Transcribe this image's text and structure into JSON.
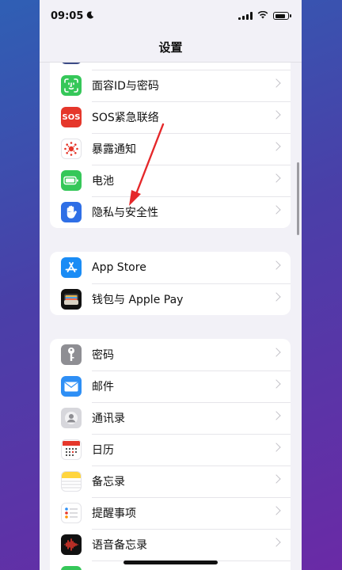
{
  "status": {
    "time": "09:05"
  },
  "nav": {
    "title": "设置"
  },
  "groups": [
    {
      "items": [
        {
          "label": "面容ID与密码",
          "icon": "face-id-icon",
          "color": "#35c759"
        },
        {
          "label": "SOS紧急联络",
          "icon": "sos-icon",
          "color": "#e5372b"
        },
        {
          "label": "暴露通知",
          "icon": "exposure-icon",
          "color": "#ffffff"
        },
        {
          "label": "电池",
          "icon": "battery-icon",
          "color": "#35c759"
        },
        {
          "label": "隐私与安全性",
          "icon": "hand-icon",
          "color": "#2f6fe6"
        }
      ]
    },
    {
      "items": [
        {
          "label": "App Store",
          "icon": "app-store-icon",
          "color": "#1a8cf5"
        },
        {
          "label": "钱包与 Apple Pay",
          "icon": "wallet-icon",
          "color": "#111111"
        }
      ]
    },
    {
      "items": [
        {
          "label": "密码",
          "icon": "key-icon",
          "color": "#8e8e93"
        },
        {
          "label": "邮件",
          "icon": "mail-icon",
          "color": "#2e8ff5"
        },
        {
          "label": "通讯录",
          "icon": "contacts-icon",
          "color": "#d7d7dc"
        },
        {
          "label": "日历",
          "icon": "calendar-icon",
          "color": "#ffffff"
        },
        {
          "label": "备忘录",
          "icon": "notes-icon",
          "color": "#ffd53e"
        },
        {
          "label": "提醒事项",
          "icon": "reminders-icon",
          "color": "#ffffff"
        },
        {
          "label": "语音备忘录",
          "icon": "voice-memos-icon",
          "color": "#111111"
        }
      ]
    }
  ]
}
